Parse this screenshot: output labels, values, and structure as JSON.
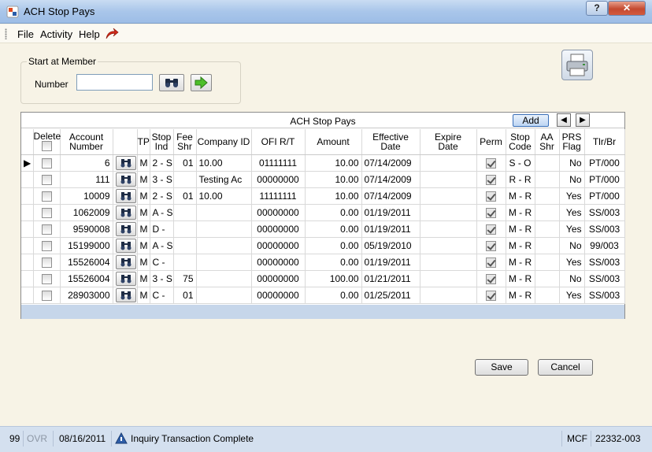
{
  "window": {
    "title": "ACH Stop Pays"
  },
  "menu": {
    "file": "File",
    "activity": "Activity",
    "help": "Help"
  },
  "start_member": {
    "title": "Start at Member",
    "number_label": "Number",
    "number_value": ""
  },
  "grid": {
    "title": "ACH Stop Pays",
    "add_label": "Add",
    "headers": {
      "delete": "Delete",
      "account": [
        "Account",
        "Number"
      ],
      "tp": "TP",
      "stop_ind": [
        "Stop",
        "Ind"
      ],
      "fee_shr": [
        "Fee",
        "Shr"
      ],
      "company_id": "Company ID",
      "ofi": "OFI R/T",
      "amount": "Amount",
      "effective": [
        "Effective",
        "Date"
      ],
      "expire": [
        "Expire",
        "Date"
      ],
      "perm": "Perm",
      "stop_code": [
        "Stop",
        "Code"
      ],
      "aa_shr": [
        "AA",
        "Shr"
      ],
      "prs": [
        "PRS",
        "Flag"
      ],
      "tlr": "Tlr/Br"
    },
    "rows": [
      {
        "account": "6",
        "tp": "M",
        "stop_ind": "2 - S",
        "fee_shr": "01",
        "company_id": "10.00",
        "ofi": "01111111",
        "amount": "10.00",
        "effective": "07/14/2009",
        "expire": "",
        "stop_code": "S - O",
        "aa_shr": "",
        "prs": "No",
        "tlr": "PT/000"
      },
      {
        "account": "111",
        "tp": "M",
        "stop_ind": "3 - S",
        "fee_shr": "",
        "company_id": "Testing Ac",
        "ofi": "00000000",
        "amount": "10.00",
        "effective": "07/14/2009",
        "expire": "",
        "stop_code": "R - R",
        "aa_shr": "",
        "prs": "No",
        "tlr": "PT/000"
      },
      {
        "account": "10009",
        "tp": "M",
        "stop_ind": "2 - S",
        "fee_shr": "01",
        "company_id": "10.00",
        "ofi": "11111111",
        "amount": "10.00",
        "effective": "07/14/2009",
        "expire": "",
        "stop_code": "M - R",
        "aa_shr": "",
        "prs": "Yes",
        "tlr": "PT/000"
      },
      {
        "account": "1062009",
        "tp": "M",
        "stop_ind": "A - S",
        "fee_shr": "",
        "company_id": "",
        "ofi": "00000000",
        "amount": "0.00",
        "effective": "01/19/2011",
        "expire": "",
        "stop_code": "M - R",
        "aa_shr": "",
        "prs": "Yes",
        "tlr": "SS/003"
      },
      {
        "account": "9590008",
        "tp": "M",
        "stop_ind": "D -",
        "fee_shr": "",
        "company_id": "",
        "ofi": "00000000",
        "amount": "0.00",
        "effective": "01/19/2011",
        "expire": "",
        "stop_code": "M - R",
        "aa_shr": "",
        "prs": "Yes",
        "tlr": "SS/003"
      },
      {
        "account": "15199000",
        "tp": "M",
        "stop_ind": "A - S",
        "fee_shr": "",
        "company_id": "",
        "ofi": "00000000",
        "amount": "0.00",
        "effective": "05/19/2010",
        "expire": "",
        "stop_code": "M - R",
        "aa_shr": "",
        "prs": "No",
        "tlr": "99/003"
      },
      {
        "account": "15526004",
        "tp": "M",
        "stop_ind": "C -",
        "fee_shr": "",
        "company_id": "",
        "ofi": "00000000",
        "amount": "0.00",
        "effective": "01/19/2011",
        "expire": "",
        "stop_code": "M - R",
        "aa_shr": "",
        "prs": "Yes",
        "tlr": "SS/003"
      },
      {
        "account": "15526004",
        "tp": "M",
        "stop_ind": "3 - S",
        "fee_shr": "75",
        "company_id": "",
        "ofi": "00000000",
        "amount": "100.00",
        "effective": "01/21/2011",
        "expire": "",
        "stop_code": "M - R",
        "aa_shr": "",
        "prs": "No",
        "tlr": "SS/003"
      },
      {
        "account": "28903000",
        "tp": "M",
        "stop_ind": "C -",
        "fee_shr": "01",
        "company_id": "",
        "ofi": "00000000",
        "amount": "0.00",
        "effective": "01/25/2011",
        "expire": "",
        "stop_code": "M - R",
        "aa_shr": "",
        "prs": "Yes",
        "tlr": "SS/003"
      }
    ]
  },
  "buttons": {
    "save": "Save",
    "cancel": "Cancel"
  },
  "status": {
    "code": "99",
    "ovr": "OVR",
    "date": "08/16/2011",
    "message": "Inquiry Transaction Complete",
    "mcf": "MCF",
    "session": "22332-003"
  }
}
